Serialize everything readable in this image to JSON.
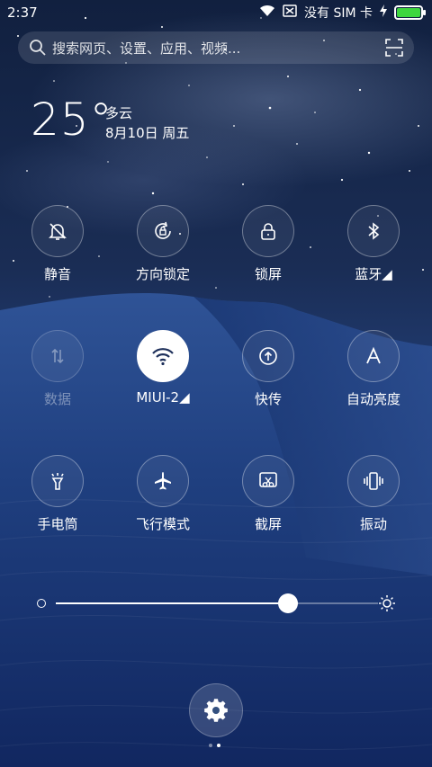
{
  "status_bar": {
    "time": "2:37",
    "carrier": "没有 SIM 卡",
    "battery_level": 1.0,
    "battery_color": "#3ed63e"
  },
  "search": {
    "placeholder": "搜索网页、设置、应用、视频..."
  },
  "weather": {
    "temperature": "25°",
    "condition": "多云",
    "date": "8月10日 周五"
  },
  "tiles": [
    {
      "label": "静音",
      "icon": "bell-off-icon",
      "active": false
    },
    {
      "label": "方向锁定",
      "icon": "rotation-lock-icon",
      "active": false
    },
    {
      "label": "锁屏",
      "icon": "lock-icon",
      "active": false
    },
    {
      "label": "蓝牙◢",
      "icon": "bluetooth-icon",
      "active": false
    },
    {
      "label": "数据",
      "icon": "mobile-data-icon",
      "active": false,
      "disabled": true
    },
    {
      "label": "MIUI-2◢",
      "icon": "wifi-icon",
      "active": true
    },
    {
      "label": "快传",
      "icon": "share-upload-icon",
      "active": false
    },
    {
      "label": "自动亮度",
      "icon": "auto-brightness-icon",
      "active": false
    },
    {
      "label": "手电筒",
      "icon": "flashlight-icon",
      "active": false
    },
    {
      "label": "飞行模式",
      "icon": "airplane-icon",
      "active": false
    },
    {
      "label": "截屏",
      "icon": "screenshot-icon",
      "active": false
    },
    {
      "label": "振动",
      "icon": "vibrate-icon",
      "active": false
    }
  ],
  "brightness": {
    "level": 0.72
  },
  "colors": {
    "accent_active_tile": "#ffffff",
    "wifi_icon_on_active": "#1d2f5a"
  },
  "pager": {
    "pages": 2,
    "current": 2
  }
}
